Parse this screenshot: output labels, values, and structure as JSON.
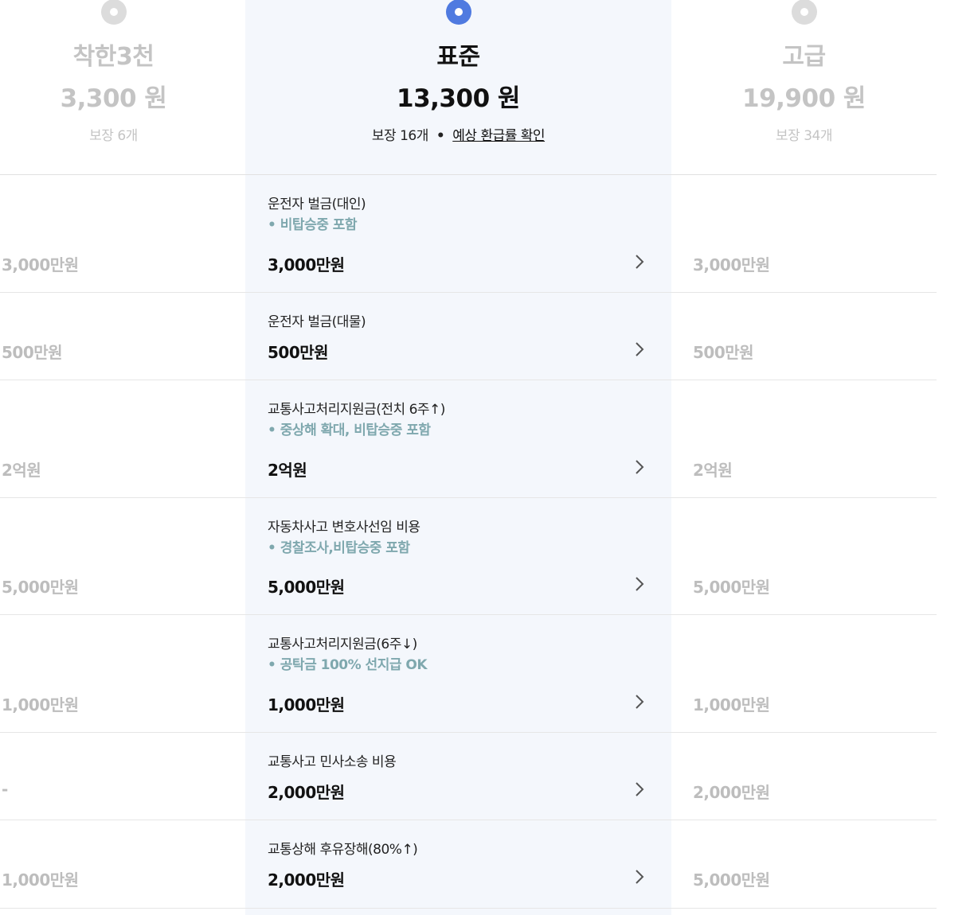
{
  "plans": [
    {
      "name": "착한3천",
      "price": "3,300 원",
      "coverage_count": "보장 6개",
      "selected": false
    },
    {
      "name": "표준",
      "price": "13,300 원",
      "coverage_count": "보장 16개",
      "selected": true,
      "refund_link": "예상 환급률 확인",
      "separator": "•"
    },
    {
      "name": "고급",
      "price": "19,900 원",
      "coverage_count": "보장 34개",
      "selected": false
    }
  ],
  "rows": [
    {
      "title": "운전자 벌금(대인)",
      "note": "• 비탑승중 포함",
      "left": "3,000만원",
      "mid": "3,000만원",
      "right": "3,000만원"
    },
    {
      "title": "운전자 벌금(대물)",
      "note": "",
      "left": "500만원",
      "mid": "500만원",
      "right": "500만원"
    },
    {
      "title": "교통사고처리지원금(전치 6주↑)",
      "note": "• 중상해 확대, 비탑승중 포함",
      "left": "2억원",
      "mid": "2억원",
      "right": "2억원"
    },
    {
      "title": "자동차사고 변호사선임 비용",
      "note": "• 경찰조사,비탑승중 포함",
      "left": "5,000만원",
      "mid": "5,000만원",
      "right": "5,000만원"
    },
    {
      "title": "교통사고처리지원금(6주↓)",
      "note": "• 공탁금 100% 선지급 OK",
      "left": "1,000만원",
      "mid": "1,000만원",
      "right": "1,000만원"
    },
    {
      "title": "교통사고 민사소송 비용",
      "note": "",
      "left": "-",
      "mid": "2,000만원",
      "right": "2,000만원"
    },
    {
      "title": "교통상해 후유장해(80%↑)",
      "note": "",
      "left": "1,000만원",
      "mid": "2,000만원",
      "right": "5,000만원"
    }
  ],
  "icons": {
    "radio": "radio-button-icon",
    "chevron": "chevron-right-icon"
  },
  "colors": {
    "accent": "#4f7ae0",
    "note": "#7fa8ae",
    "muted": "#c4c4c4",
    "highlight_bg": "#f4f7fc"
  }
}
